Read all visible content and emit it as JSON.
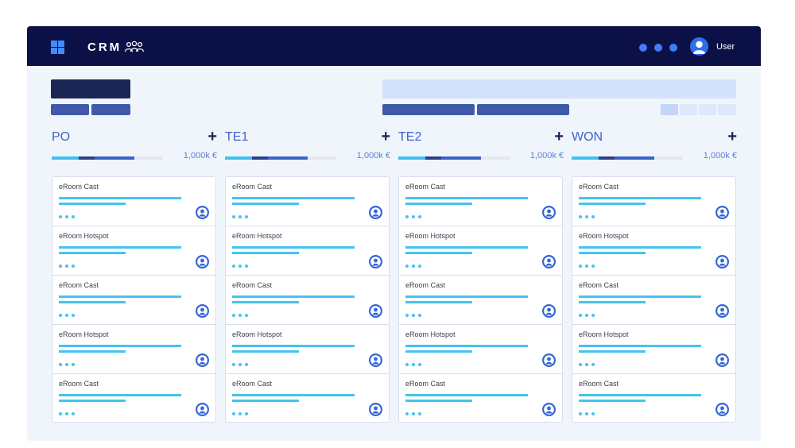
{
  "header": {
    "app_name": "CRM",
    "user_label": "User",
    "logo_icon": "grid-icon",
    "brand_icon": "people-icon",
    "menu_icon": "dots-icon",
    "avatar_icon": "user-avatar-icon"
  },
  "colors": {
    "topbar": "#0b1147",
    "accent": "#3c63c8",
    "progress_light": "#45c3ef",
    "background": "#f0f5fc"
  },
  "columns": [
    {
      "name": "PO",
      "amount": "1,000k €",
      "cards": [
        {
          "title": "eRoom Cast"
        },
        {
          "title": "eRoom Hotspot"
        },
        {
          "title": "eRoom Cast"
        },
        {
          "title": "eRoom Hotspot"
        },
        {
          "title": "eRoom Cast"
        }
      ]
    },
    {
      "name": "TE1",
      "amount": "1,000k €",
      "cards": [
        {
          "title": "eRoom Cast"
        },
        {
          "title": "eRoom Hotspot"
        },
        {
          "title": "eRoom Cast"
        },
        {
          "title": "eRoom Hotspot"
        },
        {
          "title": "eRoom Cast"
        }
      ]
    },
    {
      "name": "TE2",
      "amount": "1,000k €",
      "cards": [
        {
          "title": "eRoom Cast"
        },
        {
          "title": "eRoom Hotspot"
        },
        {
          "title": "eRoom Cast"
        },
        {
          "title": "eRoom Hotspot"
        },
        {
          "title": "eRoom Cast"
        }
      ]
    },
    {
      "name": "WON",
      "amount": "1,000k €",
      "cards": [
        {
          "title": "eRoom Cast"
        },
        {
          "title": "eRoom Hotspot"
        },
        {
          "title": "eRoom Cast"
        },
        {
          "title": "eRoom Hotspot"
        },
        {
          "title": "eRoom Cast"
        }
      ]
    }
  ]
}
